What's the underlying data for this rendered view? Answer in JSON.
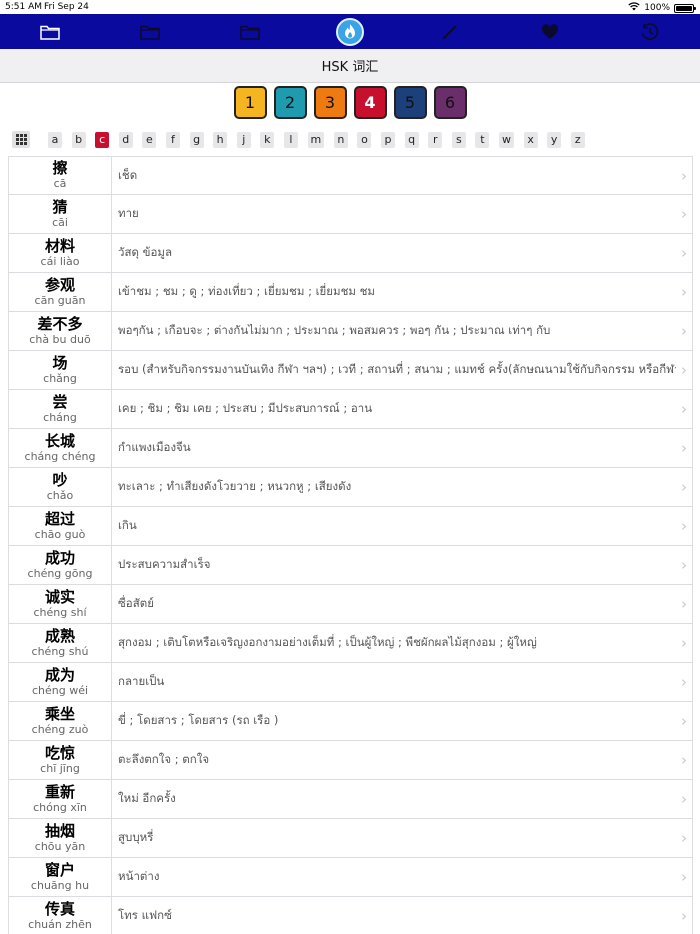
{
  "status": {
    "time": "5:51 AM",
    "date": "Fri Sep 24",
    "battery": "100%"
  },
  "toolbar": {
    "color": "#0a0a9e",
    "items": [
      {
        "icon": "folder-icon"
      },
      {
        "icon": "folder-icon"
      },
      {
        "icon": "folder-icon"
      },
      {
        "icon": "flame-icon",
        "active": true
      },
      {
        "icon": "pencil-icon"
      },
      {
        "icon": "heart-icon"
      },
      {
        "icon": "history-icon"
      }
    ]
  },
  "title": "HSK 词汇",
  "levels": [
    {
      "label": "1",
      "color": "#f5b520"
    },
    {
      "label": "2",
      "color": "#1f9bb0"
    },
    {
      "label": "3",
      "color": "#ee7a12"
    },
    {
      "label": "4",
      "color": "#c8102e",
      "active": true
    },
    {
      "label": "5",
      "color": "#1d3f7a"
    },
    {
      "label": "6",
      "color": "#6a2f6a"
    }
  ],
  "alphabet": {
    "grid_icon": "grid-icon",
    "letters": [
      "a",
      "b",
      "c",
      "d",
      "e",
      "f",
      "g",
      "h",
      "j",
      "k",
      "l",
      "m",
      "n",
      "o",
      "p",
      "q",
      "r",
      "s",
      "t",
      "w",
      "x",
      "y",
      "z"
    ],
    "selected": "c"
  },
  "words": [
    {
      "hanzi": "擦",
      "pinyin": "cā",
      "meaning": "เช็ด"
    },
    {
      "hanzi": "猜",
      "pinyin": "cāi",
      "meaning": "ทาย"
    },
    {
      "hanzi": "材料",
      "pinyin": "cái liào",
      "meaning": "วัสดุ ข้อมูล"
    },
    {
      "hanzi": "参观",
      "pinyin": "cān guān",
      "meaning": "เข้าชม ; ชม ; ดู ; ท่องเที่ยว ; เยี่ยมชม ; เยี่ยมชม ชม"
    },
    {
      "hanzi": "差不多",
      "pinyin": "chà bu duō",
      "meaning": "พอๆกัน ; เกือบจะ ; ต่างกันไม่มาก ; ประมาณ ; พอสมควร ; พอๆ กัน ; ประมาณ เท่าๆ กับ"
    },
    {
      "hanzi": "场",
      "pinyin": "chǎng",
      "meaning": "รอบ (สำหรับกิจกรรมงานบันเทิง กีฬา ฯลฯ) ; เวที ; สถานที่ ; สนาม ; แมทช์ ครั้ง(ลักษณนามใช้กับกิจกรรม หรือกีฬา)"
    },
    {
      "hanzi": "尝",
      "pinyin": "cháng",
      "meaning": "เคย ; ชิม ; ชิม เคย ; ประสบ ; มีประสบการณ์ ; อาน"
    },
    {
      "hanzi": "长城",
      "pinyin": "cháng chéng",
      "meaning": "กำแพงเมืองจีน"
    },
    {
      "hanzi": "吵",
      "pinyin": "chǎo",
      "meaning": "ทะเลาะ ; ทำเสียงดังโวยวาย ; หนวกหู ; เสียงดัง"
    },
    {
      "hanzi": "超过",
      "pinyin": "chāo guò",
      "meaning": "เกิน"
    },
    {
      "hanzi": "成功",
      "pinyin": "chéng gōng",
      "meaning": "ประสบความสำเร็จ"
    },
    {
      "hanzi": "诚实",
      "pinyin": "chéng shí",
      "meaning": "ซื่อสัตย์"
    },
    {
      "hanzi": "成熟",
      "pinyin": "chéng shú",
      "meaning": "สุกงอม ; เติบโตหรือเจริญงอกงามอย่างเต็มที่ ; เป็นผู้ใหญ่ ; พืชผักผลไม้สุกงอม ; ผู้ใหญ่"
    },
    {
      "hanzi": "成为",
      "pinyin": "chéng wéi",
      "meaning": "กลายเป็น"
    },
    {
      "hanzi": "乘坐",
      "pinyin": "chéng zuò",
      "meaning": "ขี่ ; โดยสาร ; โดยสาร (รถ เรือ )"
    },
    {
      "hanzi": "吃惊",
      "pinyin": "chī jīng",
      "meaning": "ตะลึงตกใจ ; ตกใจ"
    },
    {
      "hanzi": "重新",
      "pinyin": "chóng xīn",
      "meaning": "ใหม่ อีกครั้ง"
    },
    {
      "hanzi": "抽烟",
      "pinyin": "chōu yān",
      "meaning": "สูบบุหรี่"
    },
    {
      "hanzi": "窗户",
      "pinyin": "chuāng hu",
      "meaning": "หน้าต่าง"
    },
    {
      "hanzi": "传真",
      "pinyin": "chuán zhēn",
      "meaning": "โทร แฟกซ์"
    }
  ]
}
